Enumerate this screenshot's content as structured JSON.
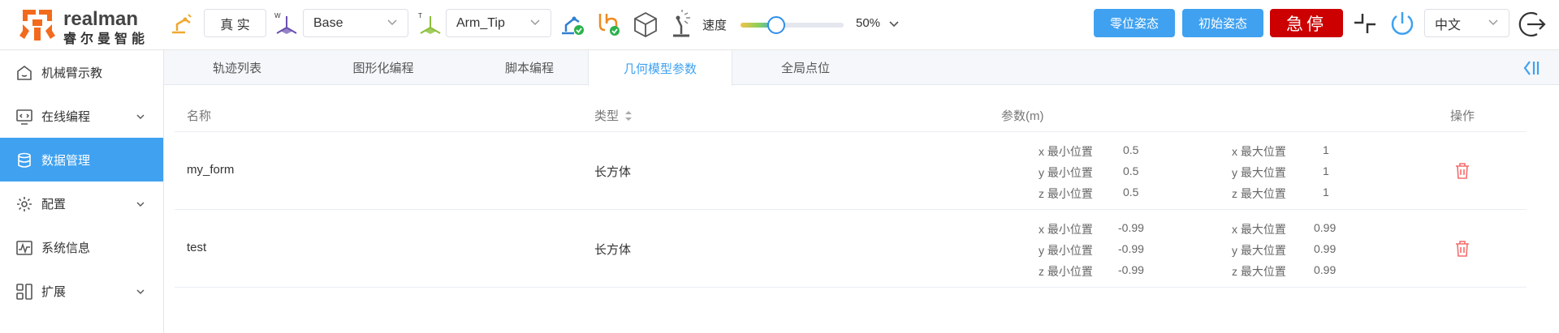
{
  "brand": {
    "name": "realman",
    "sub": "睿尔曼智能",
    "colors": {
      "logo": "#f26b1d",
      "accent": "#3fa1f0",
      "danger": "#cc0000"
    }
  },
  "toolbar": {
    "mode_label": "真 实",
    "frame_select": {
      "value": "Base",
      "prefix": "W"
    },
    "tool_select": {
      "value": "Arm_Tip",
      "prefix": "T"
    },
    "speed_label": "速度",
    "speed_value": "50%",
    "speed_percent": 50,
    "zero_pose_label": "零位姿态",
    "init_pose_label": "初始姿态",
    "estop_label": "急停",
    "language": "中文"
  },
  "sidebar": {
    "items": [
      {
        "label": "机械臂示教",
        "icon": "home-icon",
        "chevron": false,
        "active": false
      },
      {
        "label": "在线编程",
        "icon": "monitor-code-icon",
        "chevron": true,
        "active": false
      },
      {
        "label": "数据管理",
        "icon": "database-icon",
        "chevron": false,
        "active": true
      },
      {
        "label": "配置",
        "icon": "settings-gear-icon",
        "chevron": true,
        "active": false
      },
      {
        "label": "系统信息",
        "icon": "pulse-chart-icon",
        "chevron": false,
        "active": false
      },
      {
        "label": "扩展",
        "icon": "apps-grid-icon",
        "chevron": true,
        "active": false
      }
    ]
  },
  "tabs": [
    "轨迹列表",
    "图形化编程",
    "脚本编程",
    "几何模型参数",
    "全局点位"
  ],
  "active_tab": 3,
  "table": {
    "headers": {
      "name": "名称",
      "type": "类型",
      "params": "参数(m)",
      "ops": "操作"
    },
    "rows": [
      {
        "name": "my_form",
        "type": "长方体",
        "params": [
          {
            "min_label": "x 最小位置",
            "min": "0.5",
            "max_label": "x 最大位置",
            "max": "1"
          },
          {
            "min_label": "y 最小位置",
            "min": "0.5",
            "max_label": "y 最大位置",
            "max": "1"
          },
          {
            "min_label": "z 最小位置",
            "min": "0.5",
            "max_label": "z 最大位置",
            "max": "1"
          }
        ]
      },
      {
        "name": "test",
        "type": "长方体",
        "params": [
          {
            "min_label": "x 最小位置",
            "min": "-0.99",
            "max_label": "x 最大位置",
            "max": "0.99"
          },
          {
            "min_label": "y 最小位置",
            "min": "-0.99",
            "max_label": "y 最大位置",
            "max": "0.99"
          },
          {
            "min_label": "z 最小位置",
            "min": "-0.99",
            "max_label": "z 最大位置",
            "max": "0.99"
          }
        ]
      }
    ]
  }
}
